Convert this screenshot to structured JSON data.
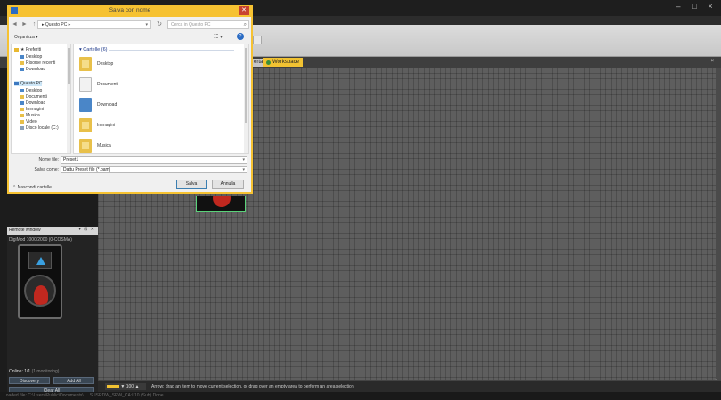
{
  "app": {
    "title": "",
    "window_controls": [
      "–",
      "□",
      "×"
    ],
    "tabs": [
      {
        "label": "erta"
      },
      {
        "label": "Workspace"
      }
    ],
    "tab_pin": "×"
  },
  "remote_window": {
    "title": "Remote window",
    "controls": "▾ ⊡ ✕",
    "device_label": "DigiMod 1000/2000 (0-COSMA)",
    "online_label": "Online: 1/1",
    "monitoring_label": "(1 monitoring)",
    "discovery_label": "Discovery",
    "add_all_label": "Add All",
    "clear_all_label": "Clear All"
  },
  "workspace": {
    "corner_label": "◔",
    "bottom_icons_label": "▼ 100 ▲",
    "hint": "Arrow: drag an item to move current selection, or drag over an empty area to perform an area selection"
  },
  "status_bar": {
    "text": "Loaded file: C:\\Users\\Public\\Documents\\ ...   SUSRDW_SPW_CA:L10 (Sub)   Done"
  },
  "dialog": {
    "title": "Salva con nome",
    "close_glyph": "✕",
    "nav": {
      "back": "◄",
      "forward": "►",
      "up": "↑"
    },
    "address": "▸ Questo PC ▸",
    "refresh": "↻",
    "search_placeholder": "Cerca in Questo PC",
    "organize_label": "Organizza ▾",
    "view_glyph": "☷ ▾",
    "help_glyph": "?",
    "nav_tree": [
      {
        "label": "★ Preferiti",
        "icon": "star-icon"
      },
      {
        "label": "Desktop",
        "icon": "desktop-icon"
      },
      {
        "label": "Risorse recenti",
        "icon": "recent-icon"
      },
      {
        "label": "Download",
        "icon": "download-icon"
      },
      {
        "label": "Questo PC",
        "icon": "computer-icon"
      },
      {
        "label": "Desktop",
        "icon": "desktop-icon"
      },
      {
        "label": "Documenti",
        "icon": "folder-icon"
      },
      {
        "label": "Download",
        "icon": "download-icon"
      },
      {
        "label": "Immagini",
        "icon": "folder-icon"
      },
      {
        "label": "Musica",
        "icon": "folder-icon"
      },
      {
        "label": "Video",
        "icon": "folder-icon"
      },
      {
        "label": "Disco locale (C:)",
        "icon": "drive-icon"
      }
    ],
    "group_header": "▾ Cartelle (6)",
    "folders": [
      {
        "label": "Desktop",
        "icon": "desktop-folder-icon"
      },
      {
        "label": "Documenti",
        "icon": "documents-folder-icon"
      },
      {
        "label": "Download",
        "icon": "download-folder-icon"
      },
      {
        "label": "Immagini",
        "icon": "pictures-folder-icon"
      },
      {
        "label": "Musica",
        "icon": "music-folder-icon"
      }
    ],
    "filename_label": "Nome file:",
    "filename_value": "Preset1",
    "filetype_label": "Salva come:",
    "filetype_value": "Dattu Preset file (*.pam)",
    "hide_folders_label": "⌃ Nascondi cartelle",
    "save_label": "Salva",
    "cancel_label": "Annulla"
  },
  "colors": {
    "dialog_frame": "#f6c232",
    "workspace_tab": "#f1c232",
    "workspace_grid": "#5e5e5e",
    "close_button": "#c8432f",
    "speaker_red": "#c0281f",
    "tweeter_blue": "#3aa0e0"
  }
}
